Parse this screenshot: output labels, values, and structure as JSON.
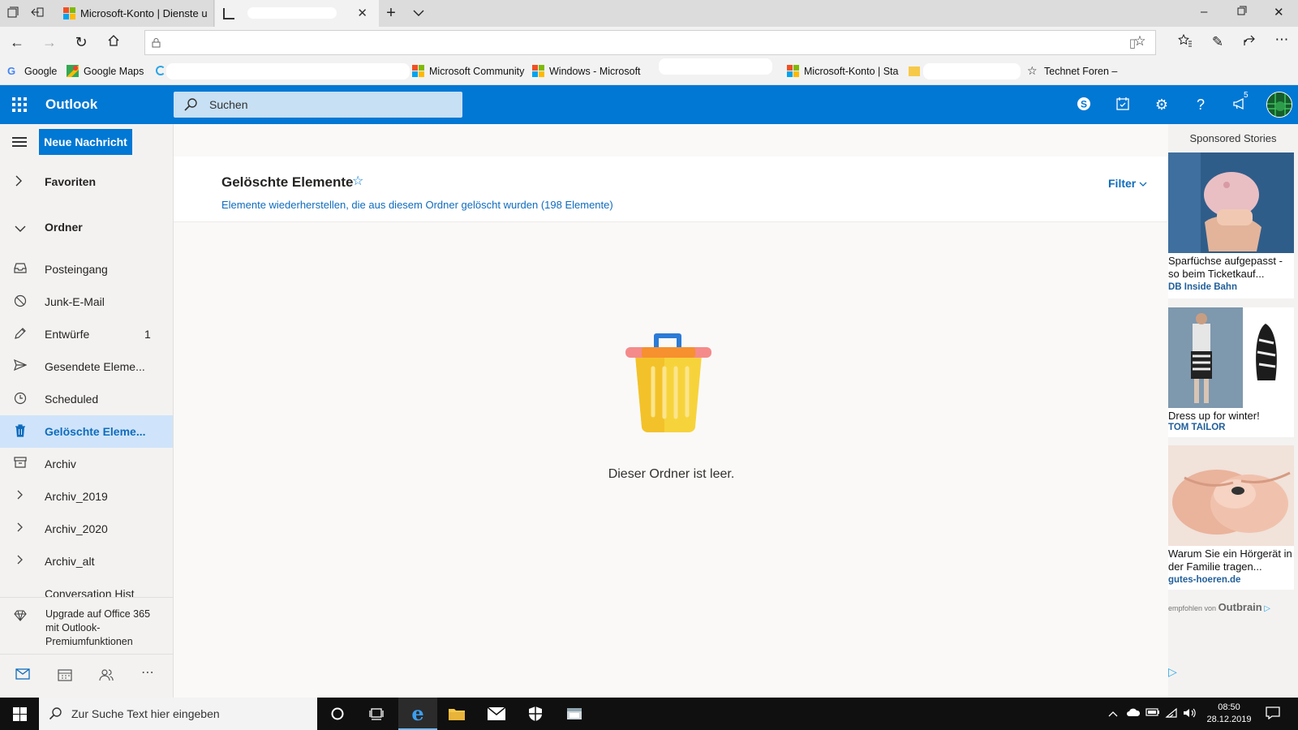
{
  "browser": {
    "tabs": [
      {
        "title": "Microsoft-Konto | Dienste u"
      },
      {
        "title": ""
      }
    ],
    "new_tab_symbol": "+",
    "favorites": [
      {
        "label": "Google"
      },
      {
        "label": "Google Maps"
      },
      {
        "label": "Microsoft Community"
      },
      {
        "label": "Windows - Microsoft"
      },
      {
        "label": "Microsoft-Konto | Sta"
      },
      {
        "label": "Technet Foren –"
      }
    ]
  },
  "outlook": {
    "brand": "Outlook",
    "search_placeholder": "Suchen",
    "notification_count": "5",
    "new_message_label": "Neue Nachricht",
    "nav": {
      "favorites_label": "Favoriten",
      "folders_label": "Ordner",
      "items": [
        {
          "label": "Posteingang",
          "icon": "inbox-icon",
          "count": ""
        },
        {
          "label": "Junk-E-Mail",
          "icon": "blocked-icon",
          "count": ""
        },
        {
          "label": "Entwürfe",
          "icon": "pencil-icon",
          "count": "1"
        },
        {
          "label": "Gesendete Eleme...",
          "icon": "send-icon",
          "count": ""
        },
        {
          "label": "Scheduled",
          "icon": "clock-icon",
          "count": ""
        },
        {
          "label": "Gelöschte Eleme...",
          "icon": "trash-icon",
          "count": "",
          "selected": true
        },
        {
          "label": "Archiv",
          "icon": "archive-icon",
          "count": ""
        },
        {
          "label": "Archiv_2019",
          "icon": "chevron-right-icon",
          "count": ""
        },
        {
          "label": "Archiv_2020",
          "icon": "chevron-right-icon",
          "count": ""
        },
        {
          "label": "Archiv_alt",
          "icon": "chevron-right-icon",
          "count": ""
        },
        {
          "label": "Conversation Hist",
          "icon": "",
          "count": ""
        }
      ],
      "upgrade_text": "Upgrade auf Office 365 mit Outlook-Premiumfunktionen"
    },
    "folder": {
      "title": "Gelöschte Elemente",
      "restore_link": "Elemente wiederherstellen, die aus diesem Ordner gelöscht wurden (198 Elemente)",
      "filter_label": "Filter",
      "empty_message": "Dieser Ordner ist leer."
    },
    "ads": {
      "header": "Sponsored Stories",
      "cards": [
        {
          "title": "Sparfüchse aufgepasst - so beim Ticketkauf...",
          "source": "DB Inside Bahn"
        },
        {
          "title": "Dress up for winter!",
          "source": "TOM TAILOR"
        },
        {
          "title": "Warum Sie ein Hörgerät in der Familie tragen...",
          "source": "gutes-hoeren.de"
        }
      ],
      "footer_prefix": "empfohlen von",
      "footer_brand": "Outbrain"
    }
  },
  "taskbar": {
    "search_placeholder": "Zur Suche Text hier eingeben",
    "time": "08:50",
    "date": "28.12.2019"
  },
  "colors": {
    "outlook_blue": "#0078d4",
    "selected_bg": "#cfe4fa",
    "link": "#0f6cbd"
  }
}
